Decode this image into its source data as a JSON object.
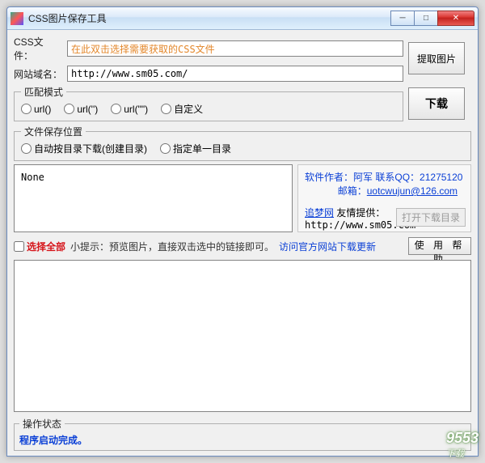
{
  "window": {
    "title": "CSS图片保存工具"
  },
  "css_file": {
    "label": "CSS文件：",
    "placeholder": "在此双击选择需要获取的CSS文件"
  },
  "domain": {
    "label": "网站域名：",
    "value": "http://www.sm05.com/"
  },
  "buttons": {
    "extract": "提取图片",
    "download": "下载",
    "open_dir": "打开下载目录",
    "help": "使 用 帮 助"
  },
  "match_mode": {
    "legend": "匹配模式",
    "options": [
      "url()",
      "url('')",
      "url(\"\")",
      "自定义"
    ]
  },
  "save_location": {
    "legend": "文件保存位置",
    "options": [
      "自动按目录下载(创建目录)",
      "指定单一目录"
    ]
  },
  "listbox": {
    "content": "None"
  },
  "info": {
    "author_label": "软件作者：",
    "author": "阿军",
    "contact_label": "联系QQ：",
    "qq": "21275120",
    "email_label": "邮箱：",
    "email": "uotcwujun@126.com",
    "site_label": "追梦网",
    "site_suffix": "友情提供：",
    "site_url": "http://www.sm05.com"
  },
  "mid": {
    "select_all": "选择全部",
    "tip": "小提示：预览图片，直接双击选中的链接即可。",
    "link": "访问官方网站下载更新"
  },
  "status": {
    "legend": "操作状态",
    "text": "程序启动完成。"
  },
  "watermark": {
    "main": "9553",
    "sub": "下载"
  }
}
